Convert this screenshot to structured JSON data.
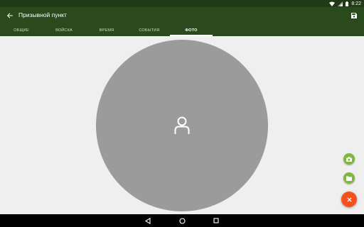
{
  "status_bar": {
    "time": "8:22",
    "icons": [
      "wifi-icon",
      "signal-icon",
      "battery-icon"
    ]
  },
  "app_bar": {
    "title": "Призывной пункт",
    "back_icon": "arrow-left-icon",
    "save_icon": "save-icon"
  },
  "tabs": [
    {
      "label": "ОБЩИЕ",
      "active": false
    },
    {
      "label": "ВОЙСКА",
      "active": false
    },
    {
      "label": "ВРЕМЯ",
      "active": false
    },
    {
      "label": "СОБЫТИЯ",
      "active": false
    },
    {
      "label": "ФОТО",
      "active": true
    }
  ],
  "photo": {
    "placeholder_icon": "person-icon"
  },
  "fabs": [
    {
      "icon": "camera-icon",
      "color": "#7fb73c"
    },
    {
      "icon": "folder-icon",
      "color": "#7fb73c"
    },
    {
      "icon": "close-icon",
      "color": "#f4511e"
    }
  ],
  "nav_bar": {
    "buttons": [
      "back-triangle-icon",
      "home-circle-icon",
      "recents-square-icon"
    ]
  },
  "colors": {
    "status_bar": "#1f3a14",
    "app_bar": "#2a4a1d",
    "background": "#efefef",
    "photo_placeholder": "#9b9b9b",
    "fab_green": "#7fb73c",
    "fab_orange": "#f4511e"
  }
}
